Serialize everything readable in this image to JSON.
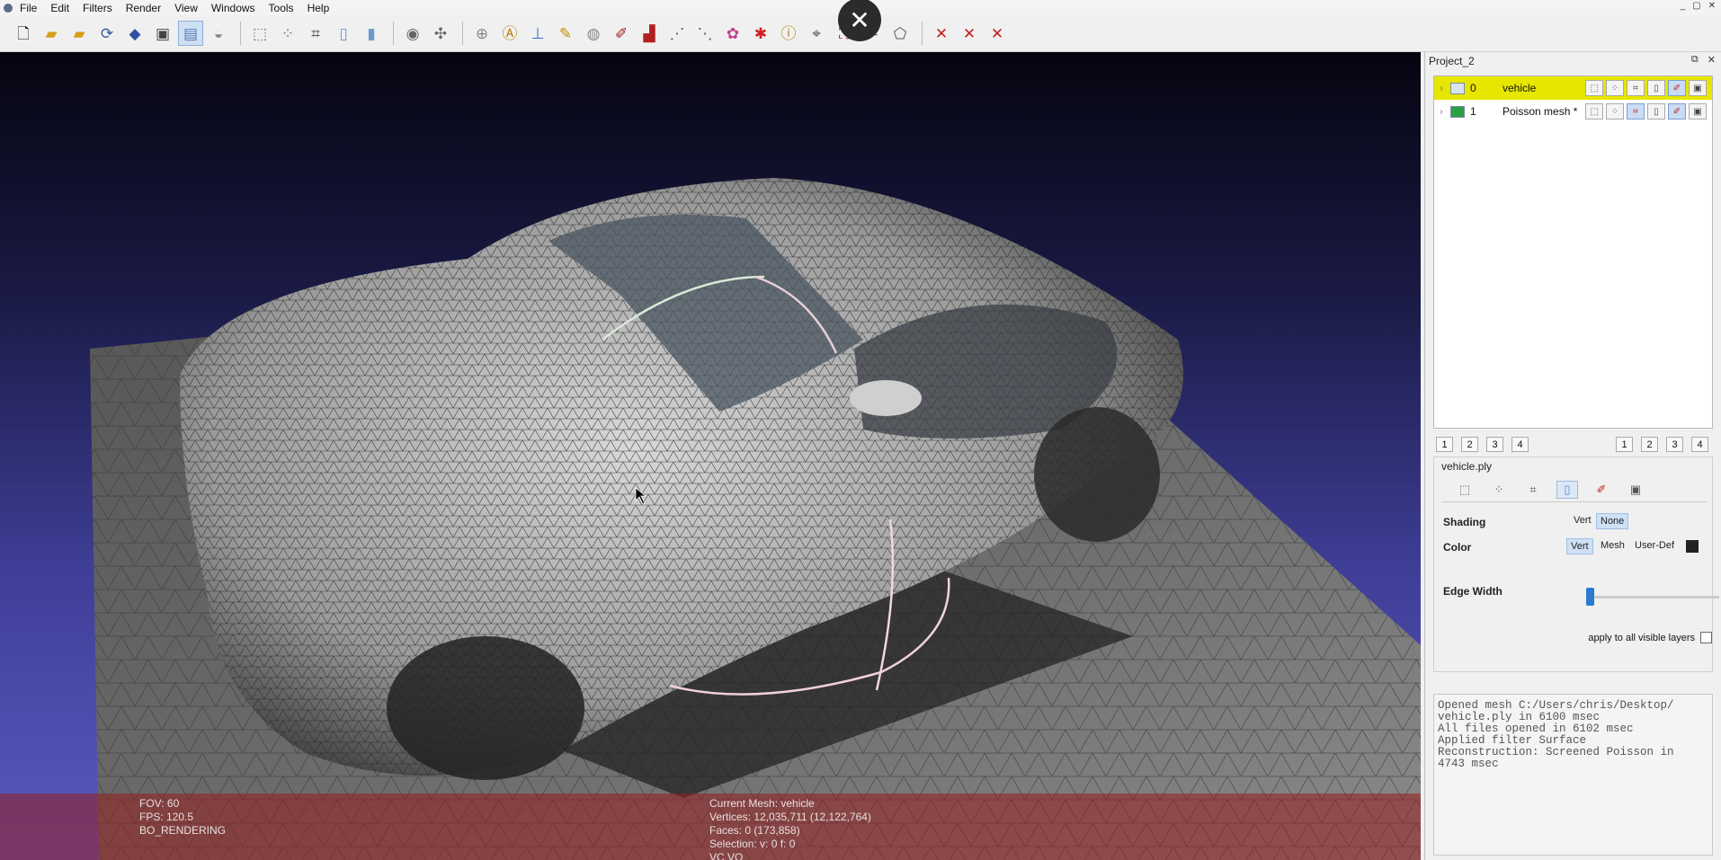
{
  "menubar": {
    "items": [
      "File",
      "Edit",
      "Filters",
      "Render",
      "View",
      "Windows",
      "Tools",
      "Help"
    ],
    "window_controls": [
      "_",
      "▢",
      "✕"
    ]
  },
  "toolbar": {
    "close_overlay_label": "✕",
    "icons": [
      "new-icon",
      "open-icon",
      "open-project-icon",
      "reload-icon",
      "save-icon",
      "snapshot-icon",
      "layer-icon",
      "mesh-icon",
      "box-icon",
      "points-icon",
      "wire-icon",
      "flat-icon",
      "smooth-icon",
      "light-icon",
      "transform-icon",
      "grid-icon",
      "annotate-icon",
      "align-icon",
      "paint-icon",
      "brush-icon",
      "pdf-icon",
      "select-icon",
      "select-vert-icon",
      "color-icon",
      "delete-icon",
      "info-icon",
      "select-faces-icon",
      "select-conn-icon",
      "select-area-icon",
      "select-draw-icon",
      "delete-faces-icon",
      "delete-verts-icon",
      "delete-all-icon"
    ]
  },
  "viewport": {
    "hud_left": [
      "FOV: 60",
      "FPS:  120.5",
      "BO_RENDERING"
    ],
    "hud_mid": [
      "Current Mesh: vehicle",
      "Vertices: 12,035,711    (12,122,764)",
      "Faces: 0    (173,858)",
      "Selection: v: 0 f: 0",
      "VC VQ"
    ]
  },
  "panel": {
    "title": "Project_2",
    "dock_icons": [
      "⧉",
      "✕"
    ],
    "layers": [
      {
        "index": "0",
        "name": "vehicle",
        "selected": true
      },
      {
        "index": "1",
        "name": "Poisson mesh *",
        "selected": false
      }
    ],
    "num_left": [
      "1",
      "2",
      "3",
      "4"
    ],
    "num_right": [
      "1",
      "2",
      "3",
      "4"
    ],
    "props_title": "vehicle.ply",
    "shading_label": "Shading",
    "shading_options": [
      "Vert",
      "None"
    ],
    "shading_selected": "None",
    "color_label": "Color",
    "color_options": [
      "Vert",
      "Mesh",
      "User-Def"
    ],
    "color_selected": "Vert",
    "user_def_color": "#222222",
    "edge_width_label": "Edge Width",
    "apply_label": "apply to all visible layers",
    "log_text": "Opened mesh C:/Users/chris/Desktop/\nvehicle.ply in 6100 msec\nAll files opened in 6102 msec\nApplied filter Surface\nReconstruction: Screened Poisson in\n4743 msec"
  }
}
